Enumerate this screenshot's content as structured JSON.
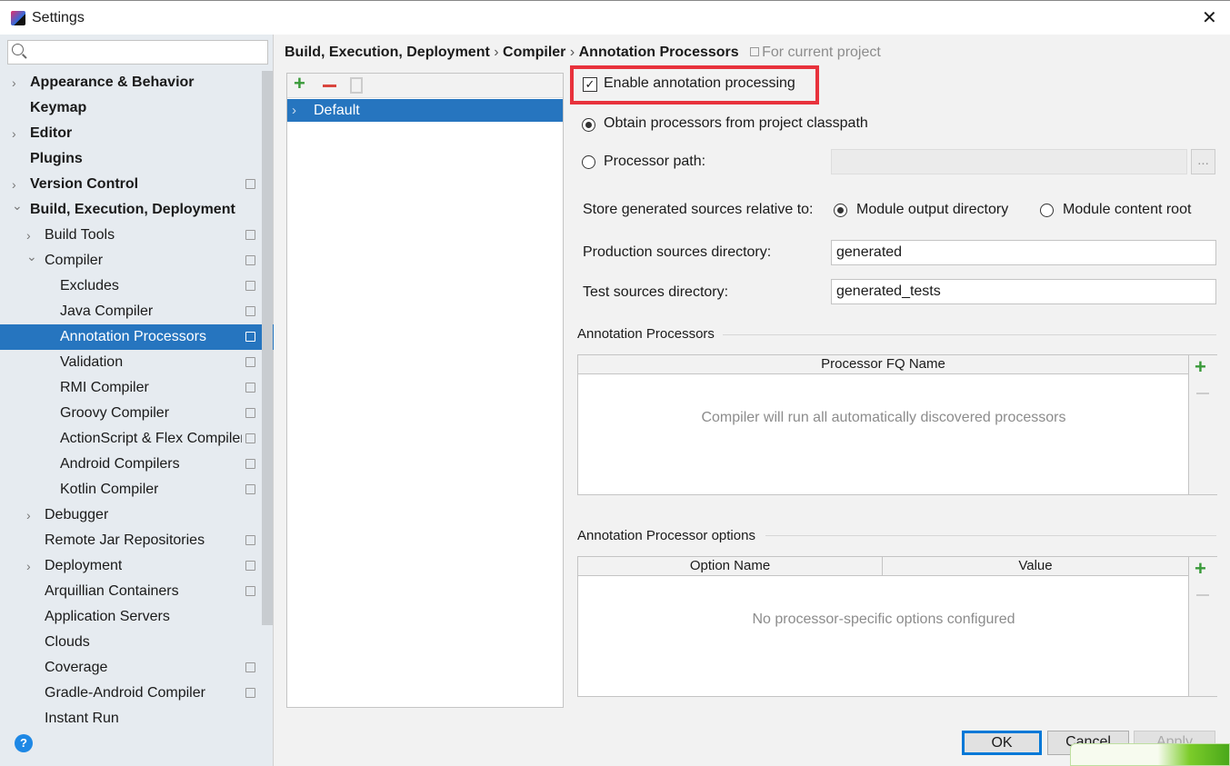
{
  "window": {
    "title": "Settings",
    "close_icon": "close-icon",
    "app_icon": "intellij-icon"
  },
  "search": {
    "placeholder": "",
    "value": ""
  },
  "tree": [
    {
      "label": "Appearance & Behavior",
      "level": 0,
      "bold": true,
      "chevron": "right",
      "copy": false
    },
    {
      "label": "Keymap",
      "level": 0,
      "bold": true,
      "chevron": "",
      "copy": false
    },
    {
      "label": "Editor",
      "level": 0,
      "bold": true,
      "chevron": "right",
      "copy": false
    },
    {
      "label": "Plugins",
      "level": 0,
      "bold": true,
      "chevron": "",
      "copy": false
    },
    {
      "label": "Version Control",
      "level": 0,
      "bold": true,
      "chevron": "right",
      "copy": true
    },
    {
      "label": "Build, Execution, Deployment",
      "level": 0,
      "bold": true,
      "chevron": "down",
      "copy": false
    },
    {
      "label": "Build Tools",
      "level": 1,
      "bold": false,
      "chevron": "right",
      "copy": true
    },
    {
      "label": "Compiler",
      "level": 1,
      "bold": false,
      "chevron": "down",
      "copy": true
    },
    {
      "label": "Excludes",
      "level": 2,
      "bold": false,
      "chevron": "",
      "copy": true
    },
    {
      "label": "Java Compiler",
      "level": 2,
      "bold": false,
      "chevron": "",
      "copy": true
    },
    {
      "label": "Annotation Processors",
      "level": 2,
      "bold": false,
      "chevron": "",
      "copy": true,
      "selected": true
    },
    {
      "label": "Validation",
      "level": 2,
      "bold": false,
      "chevron": "",
      "copy": true
    },
    {
      "label": "RMI Compiler",
      "level": 2,
      "bold": false,
      "chevron": "",
      "copy": true
    },
    {
      "label": "Groovy Compiler",
      "level": 2,
      "bold": false,
      "chevron": "",
      "copy": true
    },
    {
      "label": "ActionScript & Flex Compiler",
      "level": 2,
      "bold": false,
      "chevron": "",
      "copy": true
    },
    {
      "label": "Android Compilers",
      "level": 2,
      "bold": false,
      "chevron": "",
      "copy": true
    },
    {
      "label": "Kotlin Compiler",
      "level": 2,
      "bold": false,
      "chevron": "",
      "copy": true
    },
    {
      "label": "Debugger",
      "level": 1,
      "bold": false,
      "chevron": "right",
      "copy": false
    },
    {
      "label": "Remote Jar Repositories",
      "level": 1,
      "bold": false,
      "chevron": "",
      "copy": true
    },
    {
      "label": "Deployment",
      "level": 1,
      "bold": false,
      "chevron": "right",
      "copy": true
    },
    {
      "label": "Arquillian Containers",
      "level": 1,
      "bold": false,
      "chevron": "",
      "copy": true
    },
    {
      "label": "Application Servers",
      "level": 1,
      "bold": false,
      "chevron": "",
      "copy": false
    },
    {
      "label": "Clouds",
      "level": 1,
      "bold": false,
      "chevron": "",
      "copy": false
    },
    {
      "label": "Coverage",
      "level": 1,
      "bold": false,
      "chevron": "",
      "copy": true
    },
    {
      "label": "Gradle-Android Compiler",
      "level": 1,
      "bold": false,
      "chevron": "",
      "copy": true
    },
    {
      "label": "Instant Run",
      "level": 1,
      "bold": false,
      "chevron": "",
      "copy": false
    }
  ],
  "breadcrumb": {
    "parts": [
      "Build, Execution, Deployment",
      "Compiler",
      "Annotation Processors"
    ],
    "scope": "For current project"
  },
  "profiles": {
    "items": [
      "Default"
    ]
  },
  "settings": {
    "enable_label": "Enable annotation processing",
    "enable_checked": true,
    "obtain_label": "Obtain processors from project classpath",
    "path_label": "Processor path:",
    "path_value": "",
    "browse_label": "...",
    "obtain_selected": true,
    "store_label": "Store generated sources relative to:",
    "module_output_label": "Module output directory",
    "module_content_label": "Module content root",
    "store_selected": "module_output",
    "prod_label": "Production sources directory:",
    "prod_value": "generated",
    "test_label": "Test sources directory:",
    "test_value": "generated_tests",
    "processors_section": "Annotation Processors",
    "processors_col": "Processor FQ Name",
    "processors_empty": "Compiler will run all automatically discovered processors",
    "options_section": "Annotation Processor options",
    "options_cols": [
      "Option Name",
      "Value"
    ],
    "options_empty": "No processor-specific options configured"
  },
  "footer": {
    "ok": "OK",
    "cancel": "Cancel",
    "apply": "Apply",
    "help_icon": "help-icon"
  },
  "colors": {
    "selection": "#2675bf",
    "highlight_box": "#e8323c",
    "add": "#3a9a3a",
    "remove": "#d9463e"
  }
}
